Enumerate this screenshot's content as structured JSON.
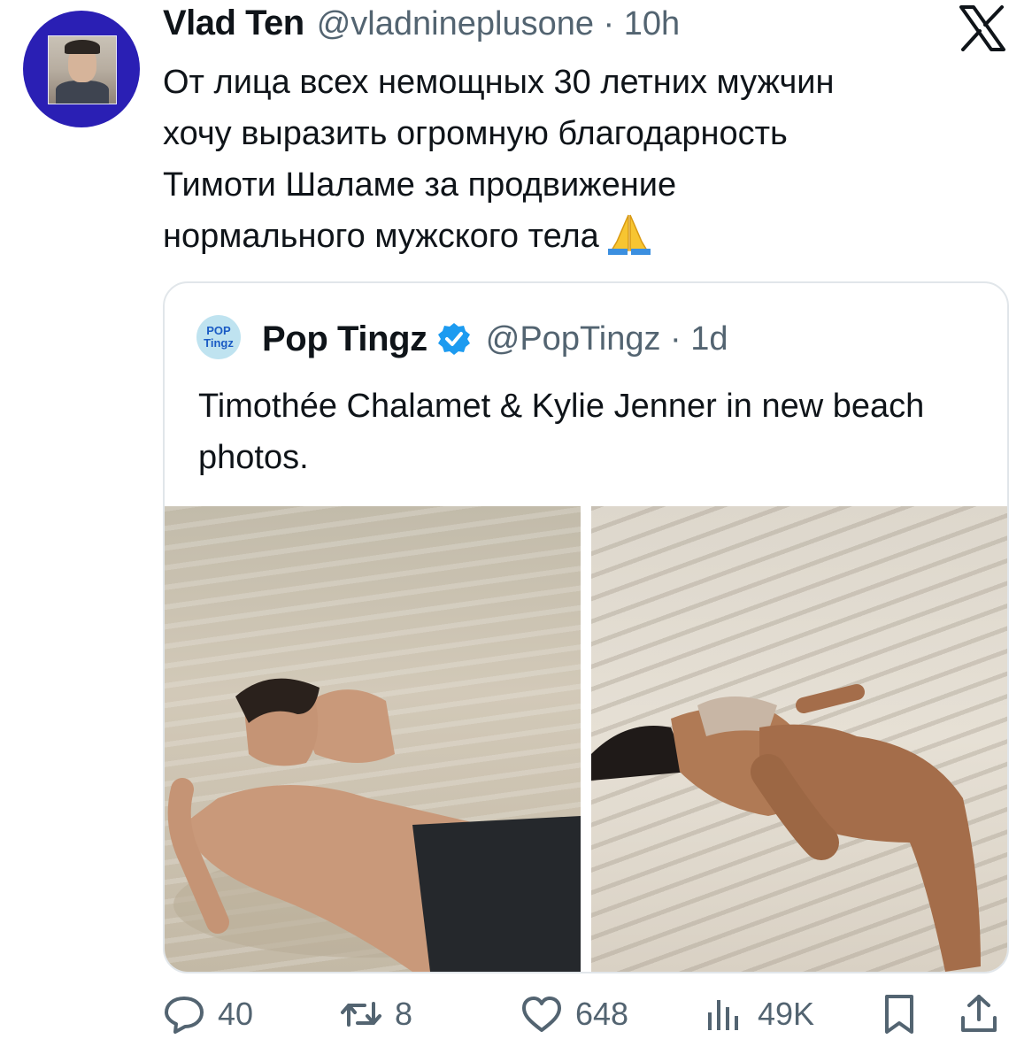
{
  "tweet": {
    "author_name": "Vlad Ten",
    "handle": "@vladnineplusone",
    "separator": "·",
    "time": "10h",
    "text_lines": [
      "От лица всех немощных 30 летних мужчин",
      "хочу выразить огромную благодарность",
      "Тимоти Шаламе за продвижение",
      "нормального мужского тела"
    ]
  },
  "quoted": {
    "avatar_text": "POP Tingz",
    "author_name": "Pop Tingz",
    "handle": "@PopTingz",
    "separator": "·",
    "time": "1d",
    "text": "Timothée Chalamet & Kylie Jenner in new beach photos."
  },
  "actions": {
    "replies": "40",
    "retweets": "8",
    "likes": "648",
    "views": "49K"
  },
  "icons": {
    "brand": "x-logo-icon",
    "emoji": "folded-hands-icon",
    "verified": "verified-badge-icon",
    "reply": "reply-icon",
    "retweet": "retweet-icon",
    "like": "heart-icon",
    "views": "views-icon",
    "bookmark": "bookmark-icon",
    "share": "share-icon"
  },
  "colors": {
    "avatar_bg": "#2a1fb4",
    "verified": "#1d9bf0",
    "secondary_text": "#536471"
  }
}
